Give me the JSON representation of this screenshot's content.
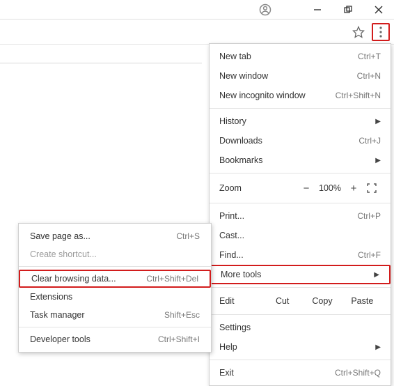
{
  "main_menu": {
    "new_tab": "New tab",
    "new_tab_sc": "Ctrl+T",
    "new_window": "New window",
    "new_window_sc": "Ctrl+N",
    "new_incog": "New incognito window",
    "new_incog_sc": "Ctrl+Shift+N",
    "history": "History",
    "downloads": "Downloads",
    "downloads_sc": "Ctrl+J",
    "bookmarks": "Bookmarks",
    "zoom": "Zoom",
    "zoom_pct": "100%",
    "zoom_minus": "−",
    "zoom_plus": "+",
    "print": "Print...",
    "print_sc": "Ctrl+P",
    "cast": "Cast...",
    "find": "Find...",
    "find_sc": "Ctrl+F",
    "more_tools": "More tools",
    "edit": "Edit",
    "cut": "Cut",
    "copy": "Copy",
    "paste": "Paste",
    "settings": "Settings",
    "help": "Help",
    "exit": "Exit",
    "exit_sc": "Ctrl+Shift+Q"
  },
  "submenu": {
    "save_page": "Save page as...",
    "save_page_sc": "Ctrl+S",
    "create_shortcut": "Create shortcut...",
    "clear_data": "Clear browsing data...",
    "clear_data_sc": "Ctrl+Shift+Del",
    "extensions": "Extensions",
    "task_manager": "Task manager",
    "task_manager_sc": "Shift+Esc",
    "developer_tools": "Developer tools",
    "developer_tools_sc": "Ctrl+Shift+I"
  }
}
